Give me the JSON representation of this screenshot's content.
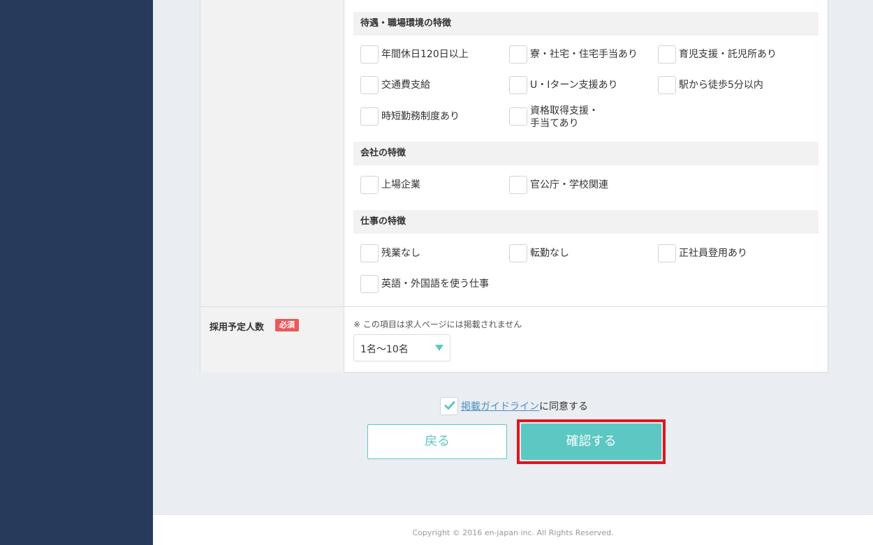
{
  "sections": {
    "treatment": {
      "title": "待遇・職場環境の特徴",
      "items": [
        "年間休日120日以上",
        "寮・社宅・住宅手当あり",
        "育児支援・託児所あり",
        "交通費支給",
        "U・Iターン支援あり",
        "駅から徒歩5分以内",
        "時短勤務制度あり",
        "資格取得支援・",
        "手当てあり"
      ]
    },
    "company": {
      "title": "会社の特徴",
      "items": [
        "上場企業",
        "官公庁・学校関連"
      ]
    },
    "job": {
      "title": "仕事の特徴",
      "items": [
        "残業なし",
        "転勤なし",
        "正社員登用あり",
        "英語・外国語を使う仕事"
      ]
    }
  },
  "hiring": {
    "label": "採用予定人数",
    "badge": "必須",
    "note": "※ この項目は求人ページには掲載されません",
    "selected": "1名〜10名"
  },
  "agree": {
    "link": "掲載ガイドライン",
    "suffix": "に同意する",
    "checked": true
  },
  "buttons": {
    "back": "戻る",
    "confirm": "確認する"
  },
  "footer": {
    "copyright": "Copyright © 2016 en-japan inc. All Rights Reserved."
  },
  "colors": {
    "sidebar": "#283a5b",
    "accent": "#5cc7c3",
    "highlight": "#e0161d",
    "badge": "#e85a5a"
  }
}
